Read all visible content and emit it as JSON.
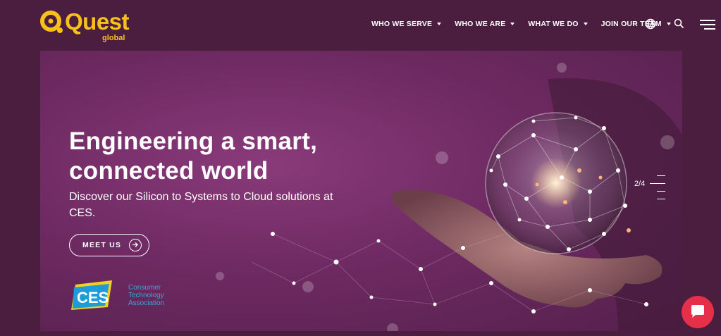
{
  "logo": {
    "word": "Quest",
    "sub": "global"
  },
  "nav": {
    "items": [
      {
        "label": "WHO WE SERVE"
      },
      {
        "label": "WHO WE ARE"
      },
      {
        "label": "WHAT WE DO"
      },
      {
        "label": "JOIN OUR TEAM"
      }
    ],
    "icons": [
      "globe-icon",
      "search-icon",
      "menu-icon"
    ]
  },
  "hero": {
    "headline": "Engineering a smart, connected world",
    "subline": "Discover our Silicon to Systems to Cloud solutions at CES.",
    "cta_label": "MEET US",
    "slide_indicator": "2/4"
  },
  "ces": {
    "mark": "CES",
    "line1": "Consumer",
    "line2": "Technology",
    "line3": "Association"
  },
  "colors": {
    "background": "#4b1d3f",
    "brand_yellow": "#f7c11a",
    "chat_red": "#e6304a",
    "ces_blue": "#3aa5d8"
  }
}
